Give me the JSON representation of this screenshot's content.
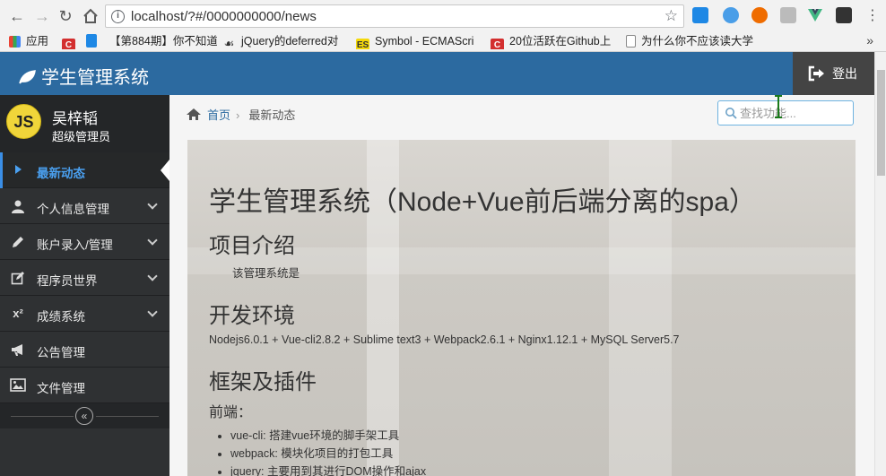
{
  "browser": {
    "url": "localhost/?#/0000000000/news",
    "bookmarks": [
      {
        "label": "应用",
        "fav_text": "",
        "fav_color": "#e94335"
      },
      {
        "label": "",
        "fav_text": "C",
        "fav_color": "#d32f2f"
      },
      {
        "label": "",
        "fav_text": "",
        "fav_color": "#1e88e5"
      },
      {
        "label": "【第884期】你不知道",
        "fav_text": "",
        "fav_color": "#2f3133"
      },
      {
        "label": "jQuery的deferred对",
        "fav_text": "",
        "fav_color": "#333333"
      },
      {
        "label": "Symbol - ECMAScri",
        "fav_text": "ES",
        "fav_color": "#f5d90a"
      },
      {
        "label": "20位活跃在Github上",
        "fav_text": "C",
        "fav_color": "#d32f2f"
      },
      {
        "label": "为什么你不应该读大学",
        "fav_text": "",
        "fav_color": "#ffffff"
      }
    ],
    "more": "»"
  },
  "header": {
    "title": "学生管理系统",
    "logout": "登出"
  },
  "user": {
    "avatar_text": "JS",
    "name": "吴梓韬",
    "role": "超级管理员"
  },
  "menu": [
    {
      "label": "最新动态",
      "icon": "play-icon",
      "active": true
    },
    {
      "label": "个人信息管理",
      "icon": "user-icon"
    },
    {
      "label": "账户录入/管理",
      "icon": "pencil-icon"
    },
    {
      "label": "程序员世界",
      "icon": "edit-icon"
    },
    {
      "label": "成绩系统",
      "icon": "superscript-icon"
    },
    {
      "label": "公告管理",
      "icon": "bullhorn-icon"
    },
    {
      "label": "文件管理",
      "icon": "picture-icon"
    }
  ],
  "collapse_glyph": "«",
  "breadcrumb": {
    "home": "首页",
    "current": "最新动态"
  },
  "search": {
    "placeholder": "查找功能..."
  },
  "doc": {
    "title": "学生管理系统（Node+Vue前后端分离的spa）",
    "h_intro": "项目介绍",
    "intro_text": "该管理系统是",
    "h_env": "开发环境",
    "env_text": "Nodejs6.0.1 + Vue-cli2.8.2 + Sublime text3 + Webpack2.6.1 + Nginx1.12.1 + MySQL Server5.7",
    "h_frame": "框架及插件",
    "frontend_label": "前端：",
    "frontend_items": [
      "vue-cli: 搭建vue环境的脚手架工具",
      "webpack: 模块化项目的打包工具",
      "jquery: 主要用到其进行DOM操作和ajax"
    ]
  },
  "colors": {
    "header_blue": "#2c6aa0",
    "sidebar": "#2f3133",
    "active_accent": "#4aa0f0"
  }
}
